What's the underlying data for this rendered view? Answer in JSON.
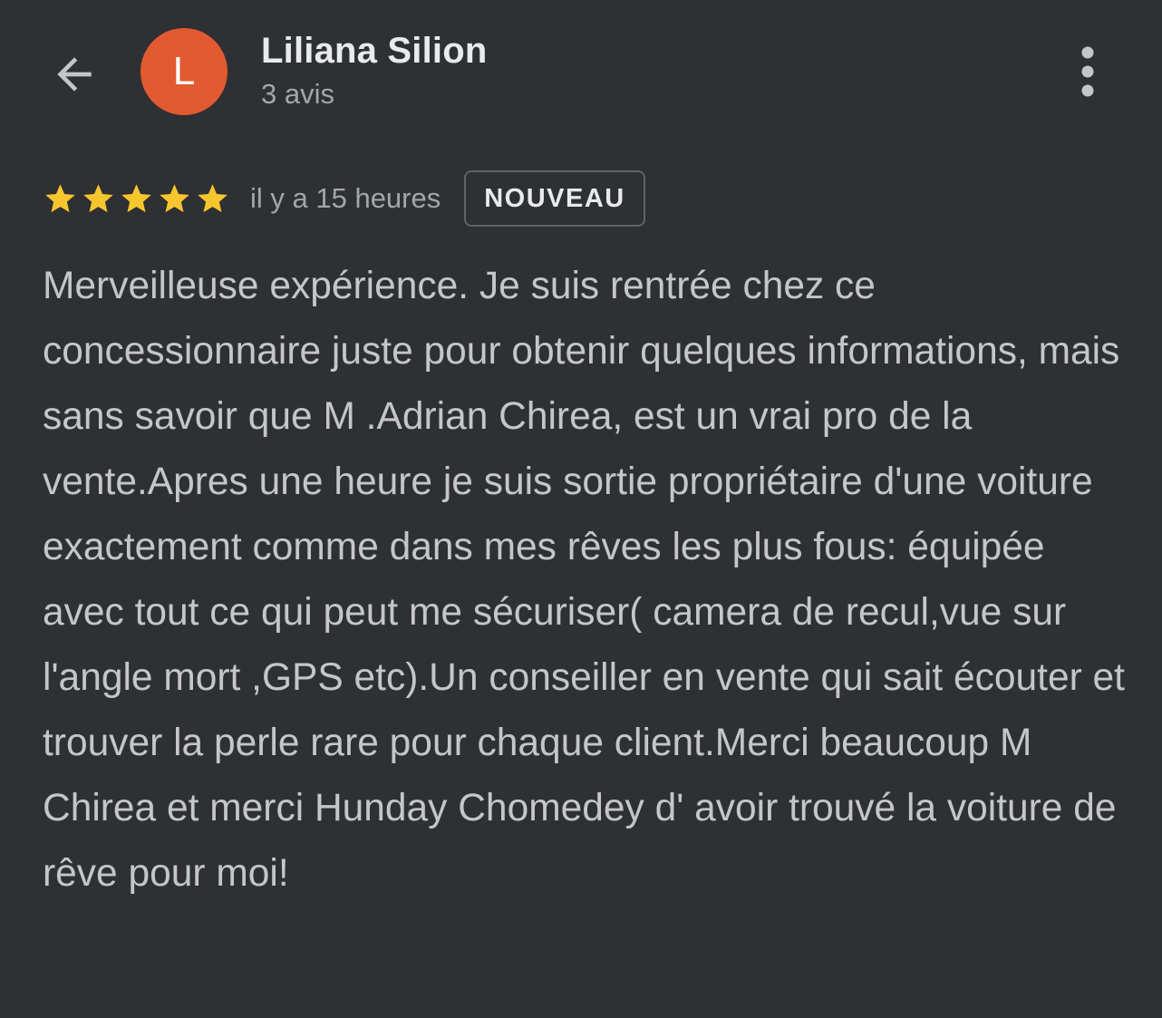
{
  "header": {
    "back_icon": "arrow-back-icon",
    "avatar_letter": "L",
    "avatar_color": "#e25a31",
    "author_name": "Liliana Silion",
    "review_count": "3 avis",
    "menu_icon": "more-vert-icon"
  },
  "review": {
    "rating": 5,
    "rating_max": 5,
    "star_color": "#f7c62f",
    "time_ago": "il y a 15 heures",
    "badge": "NOUVEAU",
    "text": "Merveilleuse expérience. Je suis rentrée chez ce concessionnaire juste pour obtenir quelques informations, mais sans savoir que M .Adrian Chirea, est un vrai pro de la vente.Apres une heure je suis sortie propriétaire d'une voiture exactement comme dans mes rêves les plus fous: équipée avec tout ce qui peut me sécuriser( camera de recul,vue sur l'angle mort ,GPS etc).Un conseiller en vente qui sait écouter et trouver la perle rare pour chaque client.Merci beaucoup M Chirea et merci Hunday Chomedey d' avoir trouvé la voiture de rêve pour moi!"
  }
}
